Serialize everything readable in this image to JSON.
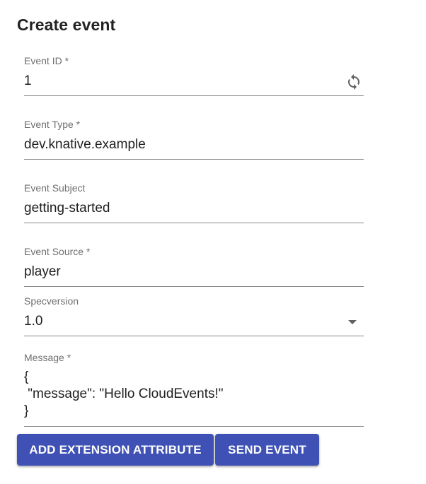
{
  "title": "Create event",
  "fields": {
    "event_id": {
      "label": "Event ID *",
      "value": "1"
    },
    "event_type": {
      "label": "Event Type *",
      "value": "dev.knative.example"
    },
    "event_subject": {
      "label": "Event Subject",
      "value": "getting-started"
    },
    "event_source": {
      "label": "Event Source *",
      "value": "player"
    },
    "specversion": {
      "label": "Specversion",
      "value": "1.0"
    },
    "message": {
      "label": "Message *",
      "value": "{\n \"message\": \"Hello CloudEvents!\"\n}"
    }
  },
  "icons": {
    "regenerate": "sync-icon",
    "dropdown": "arrow-drop-down-icon"
  },
  "buttons": {
    "add_extension": "ADD EXTENSION ATTRIBUTE",
    "send_event": "SEND EVENT"
  },
  "colors": {
    "primary": "#3f51b5",
    "icon": "#616161",
    "underline": "#8a8a8a",
    "label": "#6f6f6f"
  }
}
